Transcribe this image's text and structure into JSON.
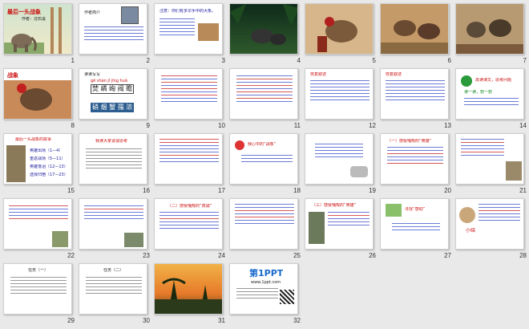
{
  "slides": [
    {
      "n": "1",
      "title": "最后一头战象",
      "author": "作者：沈石溪"
    },
    {
      "n": "2",
      "heading": "作者简介"
    },
    {
      "n": "3",
      "heading": "注意：你们有多早手中的大象。"
    },
    {
      "n": "4"
    },
    {
      "n": "5"
    },
    {
      "n": "6"
    },
    {
      "n": "7"
    },
    {
      "n": "8",
      "heading": "战象"
    },
    {
      "n": "9",
      "heading": "读读写写",
      "pinyin": "ɡē shàn jǐ jīnɡ huā",
      "chars": "焚 嶙 峋 阀 瞻",
      "chars2": "硝 烟 蟹 孺 浓"
    },
    {
      "n": "10"
    },
    {
      "n": "11"
    },
    {
      "n": "12",
      "heading": "恢复叙述"
    },
    {
      "n": "13",
      "heading": "恢复叙述"
    },
    {
      "n": "14",
      "heading": "再读课文，思考问题",
      "sub": "读一读，想一想"
    },
    {
      "n": "15",
      "heading": "最后一头战象的故事",
      "items": [
        "英雄出场（1—4）",
        "重返战场（5—11）",
        "英雄落泪（12—13）",
        "选择归宿（17—23）"
      ]
    },
    {
      "n": "16",
      "heading": "我读大家谈谈思考"
    },
    {
      "n": "17"
    },
    {
      "n": "18",
      "heading": "我心中的“战象”"
    },
    {
      "n": "19"
    },
    {
      "n": "20",
      "heading": "（一）感受嘎羧的“英雄”"
    },
    {
      "n": "21"
    },
    {
      "n": "22"
    },
    {
      "n": "23"
    },
    {
      "n": "24",
      "heading": "（二）感受嘎羧的“真诚”"
    },
    {
      "n": "25"
    },
    {
      "n": "26",
      "heading": "（三）感受嘎羧的“英雄”"
    },
    {
      "n": "27",
      "heading": "寻找“感动”"
    },
    {
      "n": "28",
      "side": "小结"
    },
    {
      "n": "29",
      "heading": "任务（一）"
    },
    {
      "n": "30",
      "heading": "任务（二）"
    },
    {
      "n": "31"
    },
    {
      "n": "32",
      "logo": "第1PPT",
      "sub": "www.1ppt.com"
    }
  ],
  "colors": {
    "accent": "#1a1a9c",
    "red": "#cc1111",
    "green": "#118822"
  }
}
